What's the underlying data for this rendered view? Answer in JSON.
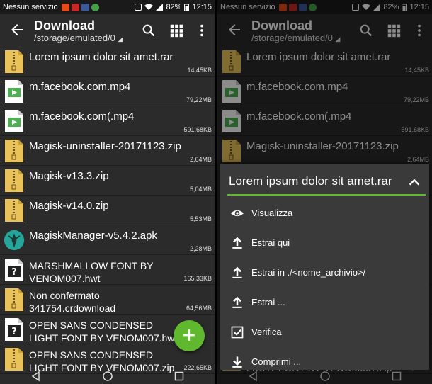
{
  "status": {
    "carrier": "Nessun servizio",
    "battery": "82%",
    "time": "12:15"
  },
  "appbar": {
    "title": "Download",
    "path": "/storage/emulated/0"
  },
  "files": [
    {
      "name": "Lorem ipsum dolor sit amet.rar",
      "size": "14,45KB",
      "type": "zip"
    },
    {
      "name": "m.facebook.com.mp4",
      "size": "79,22MB",
      "type": "video"
    },
    {
      "name": "m.facebook.com(.mp4",
      "size": "591,68KB",
      "type": "video"
    },
    {
      "name": "Magisk-uninstaller-20171123.zip",
      "size": "2,64MB",
      "type": "zip"
    },
    {
      "name": "Magisk-v13.3.zip",
      "size": "5,04MB",
      "type": "zip"
    },
    {
      "name": "Magisk-v14.0.zip",
      "size": "5,53MB",
      "type": "zip"
    },
    {
      "name": "MagiskManager-v5.4.2.apk",
      "size": "2,28MB",
      "type": "apk"
    },
    {
      "name": "MARSHMALLOW FONT BY\nVENOM007.hwt",
      "size": "165,33KB",
      "type": "unknown"
    },
    {
      "name": "Non confermato\n341754.crdownload",
      "size": "64,56MB",
      "type": "zip"
    },
    {
      "name": "OPEN SANS CONDENSED\nLIGHT FONT BY VENOM007.hwt",
      "size": "",
      "type": "unknown"
    },
    {
      "name": "OPEN SANS CONDENSED\nLIGHT FONT BY VENOM007.zip",
      "size": "222,65KB",
      "type": "zip"
    }
  ],
  "sheet": {
    "title": "Lorem ipsum dolor sit amet.rar",
    "items": [
      {
        "label": "Visualizza",
        "icon": "eye-icon"
      },
      {
        "label": "Estrai qui",
        "icon": "upload-icon"
      },
      {
        "label": "Estrai in ./<nome_archivio>/",
        "icon": "upload-icon"
      },
      {
        "label": "Estrai ...",
        "icon": "upload-icon"
      },
      {
        "label": "Verifica",
        "icon": "checkbox-icon"
      },
      {
        "label": "Comprimi ...",
        "icon": "download-icon"
      }
    ]
  },
  "fab": {
    "label": "+"
  },
  "colors": {
    "accent": "#5fb82e",
    "background": "#2b2b2b",
    "zip": "#e9c35a",
    "video": "#4caf50",
    "apk": "#26a69a"
  }
}
